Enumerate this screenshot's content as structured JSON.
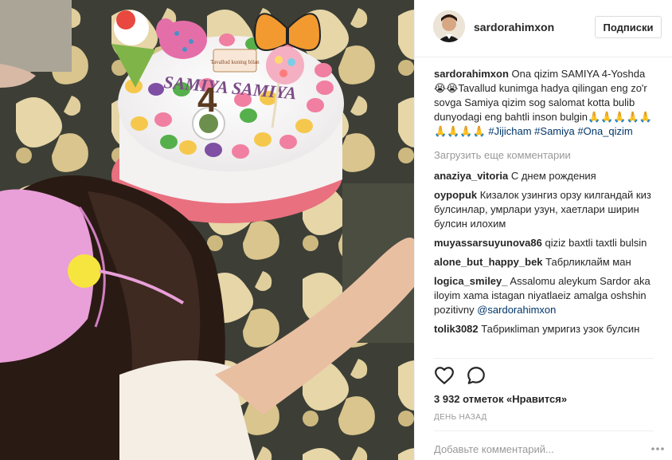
{
  "post": {
    "image_alt": "",
    "cake_text": "SAMIYA SAMIYA",
    "cake_number": "4",
    "cake_sign": "Tavallud kuning bilan"
  },
  "header": {
    "username": "sardorahimxon",
    "follow_label": "Подписки"
  },
  "caption": {
    "username": "sardorahimxon",
    "text": "Ona qizim SAMIYA 4-Yoshda😭😭Tavallud kunimga hadya qilingan eng zo'r sovga Samiya qizim sog salomat kotta bulib dunyodagi eng bahtli inson bulgin🙏🙏🙏🙏🙏🙏🙏🙏🙏 ",
    "tags": [
      "#Jijicham",
      "#Samiya",
      "#Ona_qizim"
    ]
  },
  "load_more_label": "Загрузить еще комментарии",
  "comments": [
    {
      "user": "anaziya_vitoria",
      "text": "С днем рождения"
    },
    {
      "user": "oypopuk",
      "text": "Кизалок узингиз орзу килгандай киз булсинлар, умрлари узун, хаетлари ширин булсин илохим"
    },
    {
      "user": "muyassarsuyunova86",
      "text": "qiziz baxtli taxtli bulsin"
    },
    {
      "user": "alone_but_happy_bek",
      "text": "Табрликлайм ман"
    },
    {
      "user": "logica_smiley_",
      "text": "Assalomu aleykum Sardor aka iloyim xama istagan niyatlaeiz amalga oshshin pozitivny",
      "mention": "@sardorahimxon"
    },
    {
      "user": "tolik3082",
      "text": "Табрикliman умригиз узок булсин"
    }
  ],
  "likes_text": "3 932 отметок «Нравится»",
  "time_text": "ДЕНЬ НАЗАД",
  "add_comment_placeholder": "Добавьте комментарий...",
  "icons": {
    "like": "heart-icon",
    "comment": "comment-bubble-icon",
    "more": "more-dots-icon"
  },
  "colors": {
    "link": "#003569",
    "muted": "#999999",
    "text": "#262626",
    "border": "#efefef"
  }
}
